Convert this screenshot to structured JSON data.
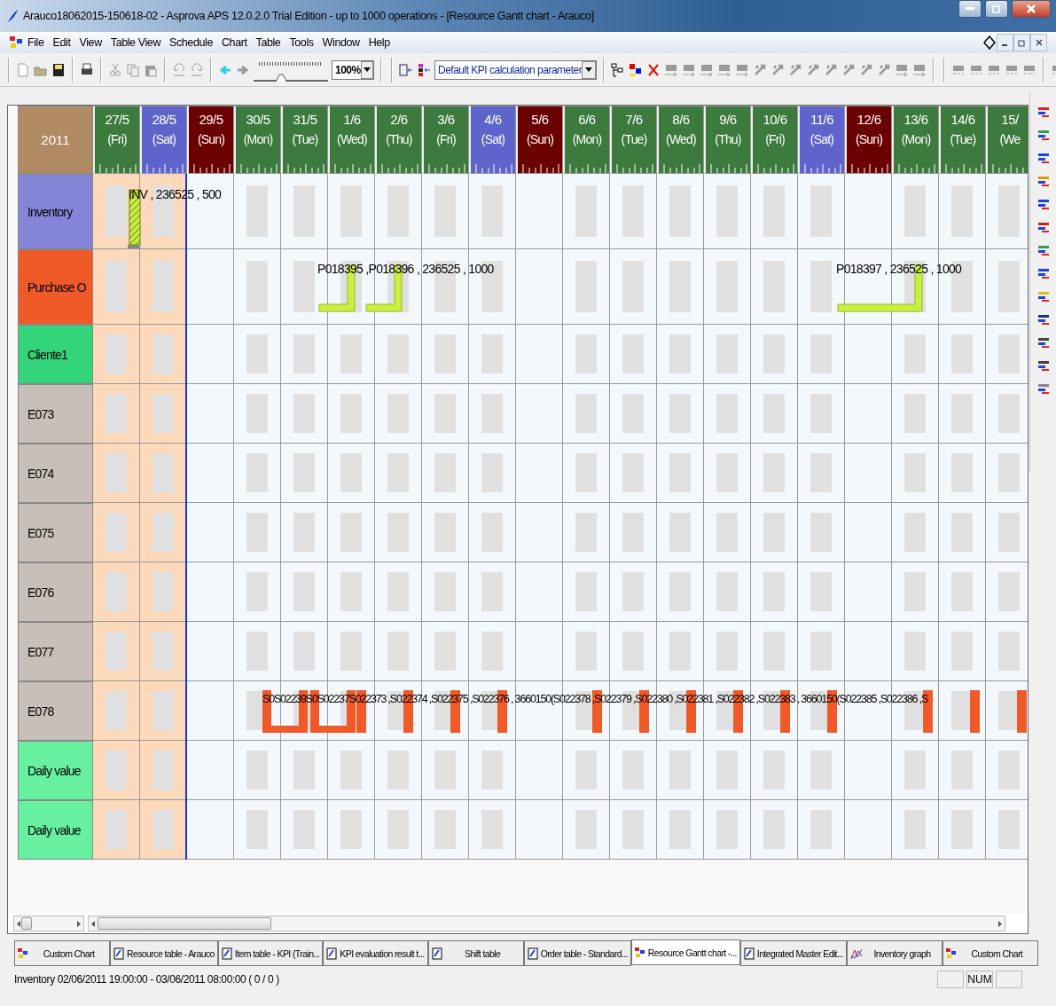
{
  "window": {
    "title": "Arauco18062015-150618-02 - Asprova APS 12.0.2.0 Trial Edition  - up to 1000 operations  - [Resource Gantt chart - Arauco]"
  },
  "menu": [
    "File",
    "Edit",
    "View",
    "Table View",
    "Schedule",
    "Chart",
    "Table",
    "Tools",
    "Window",
    "Help"
  ],
  "toolbar": {
    "zoom_slider": {
      "level": 0.35
    },
    "zoom": "100%",
    "kpi_parameter": "Default KPI calculation parameter"
  },
  "chart": {
    "year": "2011",
    "days": [
      {
        "date": "27/5",
        "weekday": "(Fri)",
        "kind": "weekday",
        "past": true
      },
      {
        "date": "28/5",
        "weekday": "(Sat)",
        "kind": "sat",
        "past": true
      },
      {
        "date": "29/5",
        "weekday": "(Sun)",
        "kind": "sun",
        "past": false
      },
      {
        "date": "30/5",
        "weekday": "(Mon)",
        "kind": "weekday",
        "past": false
      },
      {
        "date": "31/5",
        "weekday": "(Tue)",
        "kind": "weekday",
        "past": false
      },
      {
        "date": "1/6",
        "weekday": "(Wed)",
        "kind": "weekday",
        "past": false
      },
      {
        "date": "2/6",
        "weekday": "(Thu)",
        "kind": "weekday",
        "past": false
      },
      {
        "date": "3/6",
        "weekday": "(Fri)",
        "kind": "weekday",
        "past": false
      },
      {
        "date": "4/6",
        "weekday": "(Sat)",
        "kind": "sat",
        "past": false
      },
      {
        "date": "5/6",
        "weekday": "(Sun)",
        "kind": "sun",
        "past": false
      },
      {
        "date": "6/6",
        "weekday": "(Mon)",
        "kind": "weekday",
        "past": false
      },
      {
        "date": "7/6",
        "weekday": "(Tue)",
        "kind": "weekday",
        "past": false
      },
      {
        "date": "8/6",
        "weekday": "(Wed)",
        "kind": "weekday",
        "past": false
      },
      {
        "date": "9/6",
        "weekday": "(Thu)",
        "kind": "weekday",
        "past": false
      },
      {
        "date": "10/6",
        "weekday": "(Fri)",
        "kind": "weekday",
        "past": false
      },
      {
        "date": "11/6",
        "weekday": "(Sat)",
        "kind": "sat",
        "past": false
      },
      {
        "date": "12/6",
        "weekday": "(Sun)",
        "kind": "sun",
        "past": false
      },
      {
        "date": "13/6",
        "weekday": "(Mon)",
        "kind": "weekday",
        "past": false
      },
      {
        "date": "14/6",
        "weekday": "(Tue)",
        "kind": "weekday",
        "past": false
      },
      {
        "date": "15/",
        "weekday": "(We",
        "kind": "weekday",
        "past": false
      }
    ],
    "rows": [
      {
        "name": "Inventory",
        "kind": "inventory",
        "color": "#8484d8",
        "label": "INV , 236525 , 500"
      },
      {
        "name": "Purchase O",
        "kind": "purchase",
        "color": "#f05a28",
        "label": "P018395 ,P018396 , 236525 , 1000",
        "label_2": "P018397 , 236525 , 1000"
      },
      {
        "name": "Cliente1",
        "kind": "plain",
        "color": "#33d47a"
      },
      {
        "name": "E073",
        "kind": "plain",
        "color": "#c8c0b8"
      },
      {
        "name": "E074",
        "kind": "plain",
        "color": "#c8c0b8"
      },
      {
        "name": "E075",
        "kind": "plain",
        "color": "#c8c0b8"
      },
      {
        "name": "E076",
        "kind": "plain",
        "color": "#c8c0b8"
      },
      {
        "name": "E077",
        "kind": "plain",
        "color": "#c8c0b8"
      },
      {
        "name": "E078",
        "kind": "production",
        "color": "#c8c0b8",
        "label": "S0S02239S0S02237S022373 ,S022374 ,S022375 ,S022376 , 3660150(S022378 ,S022379 ,S022380 ,S022381 ,S022382 ,S022383 , 3660150(S022385 ,S022386 ,S"
      },
      {
        "name": "Daily value",
        "kind": "plain",
        "color": "#66f0a0"
      },
      {
        "name": "Daily value",
        "kind": "plain",
        "color": "#66f0a0"
      }
    ]
  },
  "tabs": [
    {
      "label": "Custom Chart",
      "kind": "chart",
      "selected": false
    },
    {
      "label": "Resource table - Arauco",
      "kind": "table",
      "selected": false
    },
    {
      "label": "Item table - KPI (Train...",
      "kind": "table",
      "selected": false
    },
    {
      "label": "KPI evaluation result t...",
      "kind": "table",
      "selected": false
    },
    {
      "label": "Shift table",
      "kind": "table",
      "selected": false
    },
    {
      "label": "Order table - Standard...",
      "kind": "table",
      "selected": false
    },
    {
      "label": "Resource Gantt chart -...",
      "kind": "chart",
      "selected": true
    },
    {
      "label": "Integrated Master Edit...",
      "kind": "table",
      "selected": false
    },
    {
      "label": "Inventory graph",
      "kind": "graph",
      "selected": false
    },
    {
      "label": "Custom Chart",
      "kind": "chart",
      "selected": false
    }
  ],
  "status_bar": {
    "text": "Inventory 02/06/2011 19:00:00 - 03/06/2011 08:00:00 ( 0 / 0 )",
    "indicator": "NUM"
  }
}
